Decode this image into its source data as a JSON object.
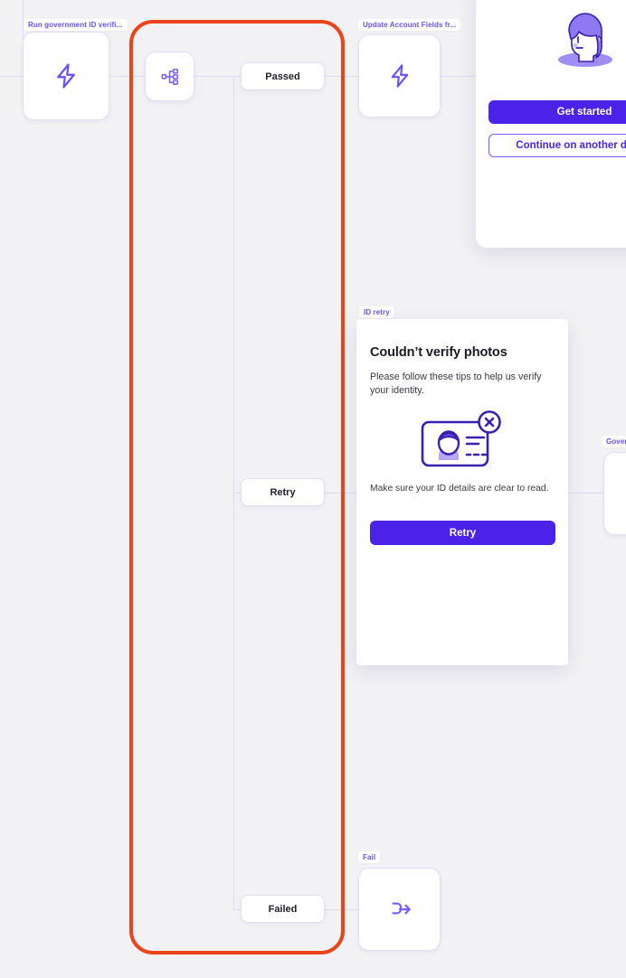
{
  "canvas": {
    "background": "#f2f2f4",
    "selection_color": "#ec4418",
    "accent": "#6d4efc"
  },
  "nodes": [
    {
      "id": "run-gov-id",
      "label": "Run government ID verifi...",
      "icon": "lightning-bolt-icon"
    },
    {
      "id": "branch",
      "label": "",
      "icon": "branch-hierarchy-icon"
    },
    {
      "id": "update-account",
      "label": "Update Account Fields fr...",
      "icon": "lightning-bolt-icon"
    },
    {
      "id": "id-retry",
      "label": "ID retry",
      "icon": "modal-preview"
    },
    {
      "id": "government",
      "label": "Governm",
      "icon": ""
    },
    {
      "id": "fail",
      "label": "Fail",
      "icon": "merge-arrow-icon"
    }
  ],
  "branches": [
    {
      "id": "passed",
      "label": "Passed"
    },
    {
      "id": "retry",
      "label": "Retry"
    },
    {
      "id": "failed",
      "label": "Failed"
    }
  ],
  "phone_preview": {
    "illustration": "person-avatar-illustration",
    "primary_button": "Get started",
    "secondary_button": "Continue on another device"
  },
  "retry_modal": {
    "badge": "ID retry",
    "title": "Couldn’t verify photos",
    "body": "Please follow these tips to help us verify your identity.",
    "illustration": "id-card-error-icon",
    "caption": "Make sure your ID details are clear to read.",
    "button": "Retry"
  }
}
